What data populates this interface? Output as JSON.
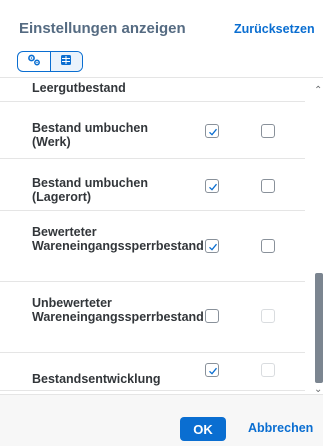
{
  "dialog": {
    "title": "Einstellungen anzeigen",
    "reset_label": "Zurücksetzen"
  },
  "toolbar": {
    "segments": [
      {
        "icon": "settings-gears-icon",
        "selected": false
      },
      {
        "icon": "table-columns-icon",
        "selected": true
      }
    ]
  },
  "list": {
    "rows": [
      {
        "label": "Leergutbestand",
        "col1": null,
        "col2": null
      },
      {
        "label": "Bestand umbuchen (Werk)",
        "col1": "checked",
        "col2": "unchecked"
      },
      {
        "label": "Bestand umbuchen (Lagerort)",
        "col1": "checked",
        "col2": "unchecked"
      },
      {
        "label": "Bewerteter Wareneingangssperrbestand",
        "col1": "checked",
        "col2": "unchecked"
      },
      {
        "label": "Unbewerteter Wareneingangssperrbestand",
        "col1": "unchecked",
        "col2": "disabled"
      },
      {
        "label": "Bestandsentwicklung",
        "col1": "checked",
        "col2": "disabled"
      }
    ]
  },
  "footer": {
    "ok_label": "OK",
    "cancel_label": "Abbrechen"
  },
  "colors": {
    "accent": "#0a6ed1",
    "title": "#556b82",
    "text": "#32363a"
  }
}
